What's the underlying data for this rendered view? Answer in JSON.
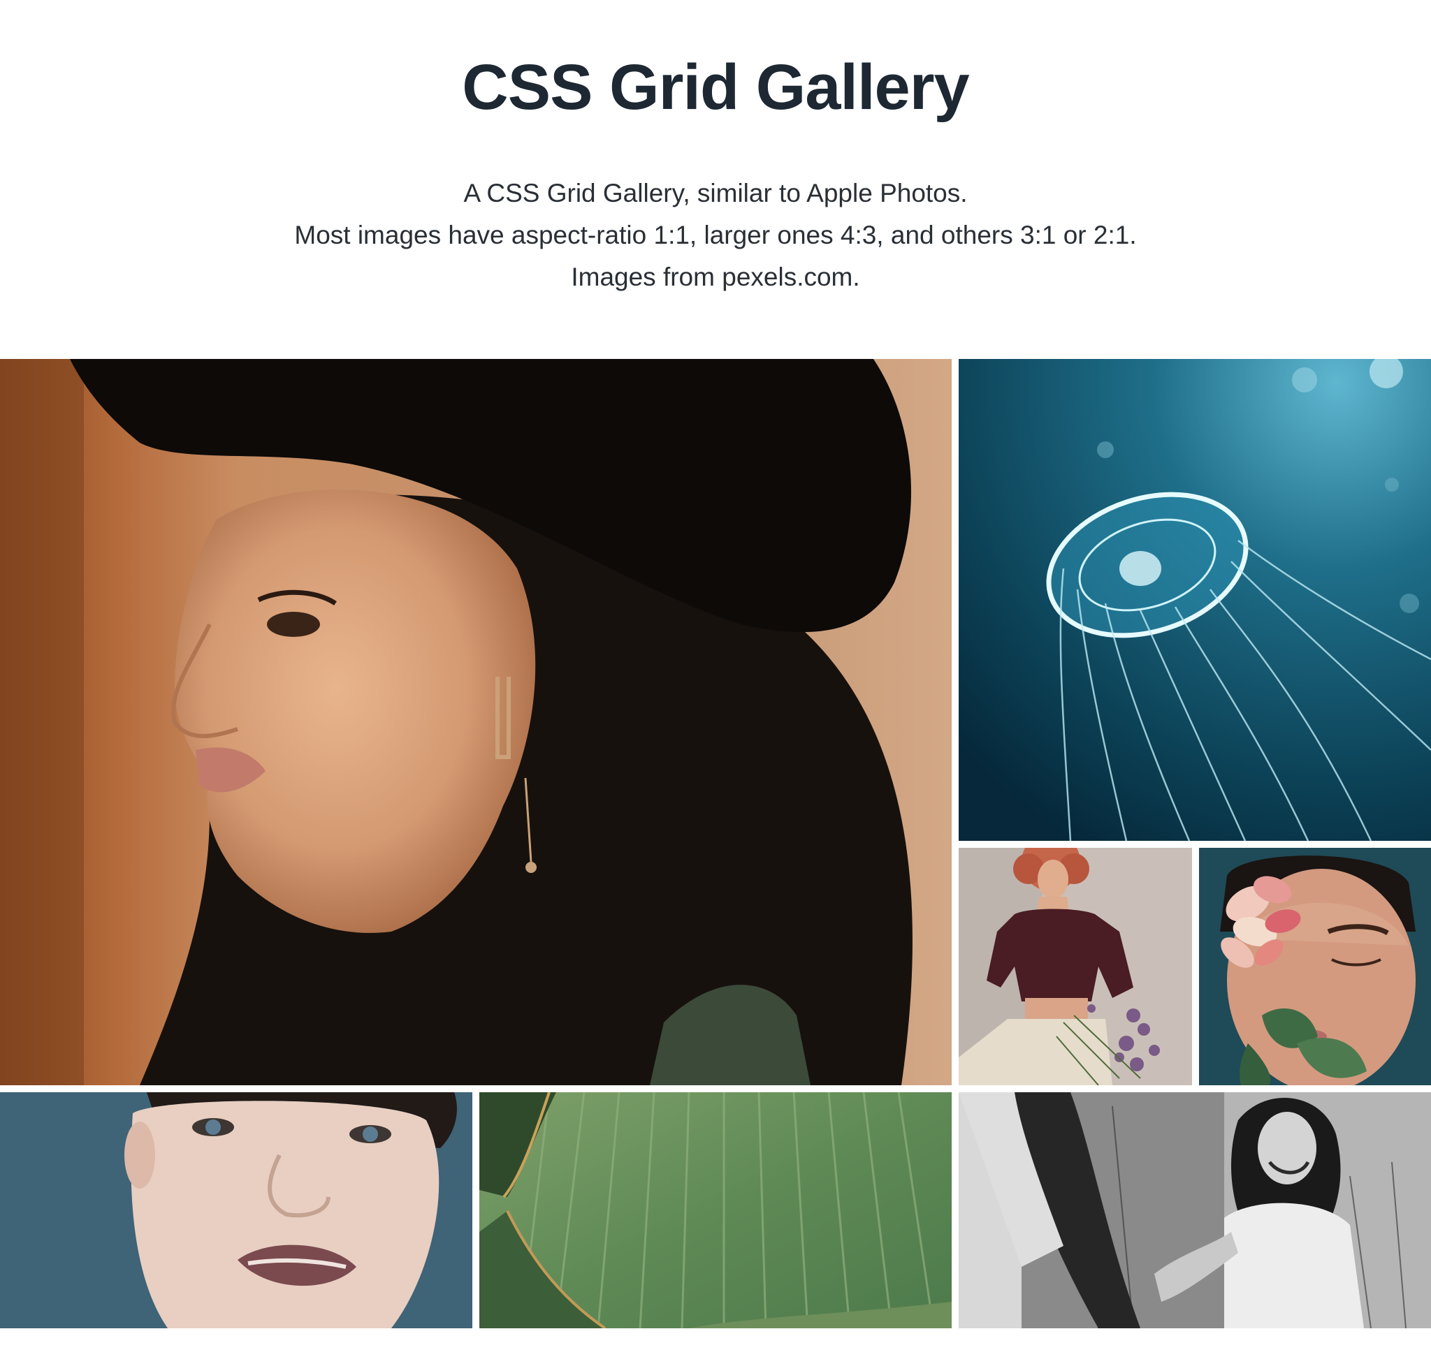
{
  "header": {
    "title": "CSS Grid Gallery",
    "intro_lines": [
      "A CSS Grid Gallery, similar to Apple Photos.",
      "Most images have aspect-ratio 1:1, larger ones 4:3, and others 3:1 or 2:1.",
      "Images from pexels.com."
    ]
  },
  "gallery": {
    "images": [
      {
        "subject": "woman-in-black-hat",
        "aspect": "4:3"
      },
      {
        "subject": "jellyfish",
        "aspect": "1:1"
      },
      {
        "subject": "woman-curly-hair-with-flowers",
        "aspect": "1:1"
      },
      {
        "subject": "woman-with-rose-petals",
        "aspect": "1:1"
      },
      {
        "subject": "close-up-face",
        "aspect": "2:1"
      },
      {
        "subject": "green-banana-leaf",
        "aspect": "2:1"
      },
      {
        "subject": "black-and-white-couple",
        "aspect": "2:1"
      }
    ]
  },
  "colors": {
    "background": "#ffffff",
    "title": "#1d2833",
    "text": "#2a2f36"
  }
}
